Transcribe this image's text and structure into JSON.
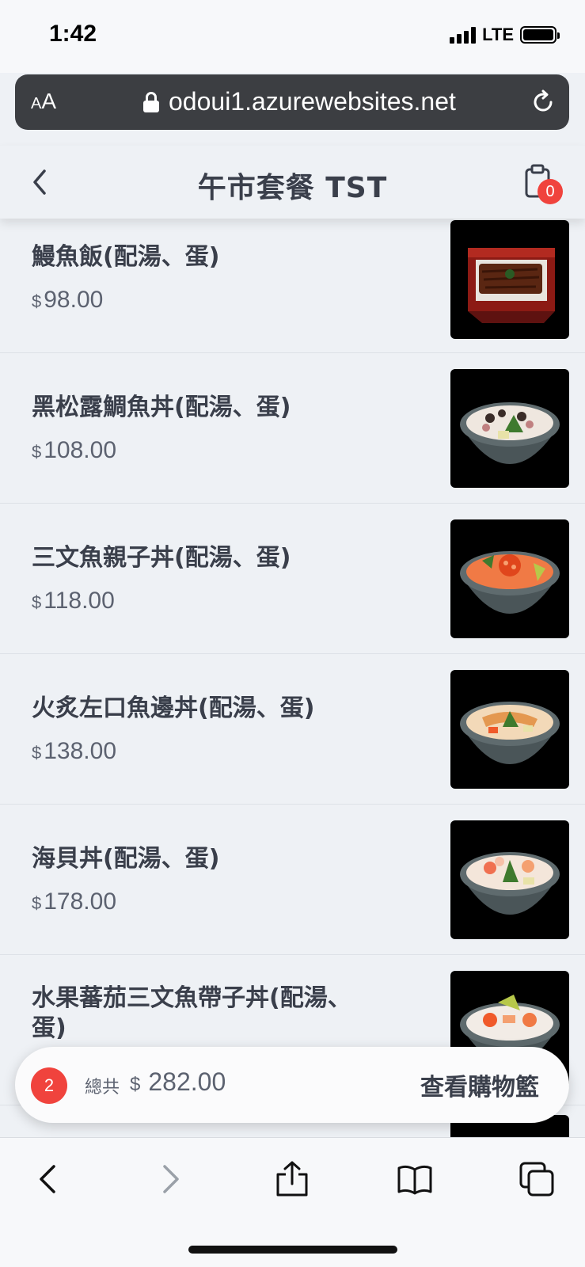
{
  "status_bar": {
    "time": "1:42",
    "network": "LTE"
  },
  "browser": {
    "aa_small": "A",
    "aa_big": "A",
    "url": "odoui1.azurewebsites.net"
  },
  "header": {
    "title": "午市套餐 TST",
    "cart_count": "0"
  },
  "currency": "$",
  "menu": [
    {
      "name": "鰻魚飯(配湯、蛋)",
      "price": "98.00",
      "image": "eel-rice-box"
    },
    {
      "name": "黑松露鯛魚丼(配湯、蛋)",
      "price": "108.00",
      "image": "truffle-sea-bream-bowl"
    },
    {
      "name": "三文魚親子丼(配湯、蛋)",
      "price": "118.00",
      "image": "salmon-roe-bowl"
    },
    {
      "name": "火炙左口魚邊丼(配湯、蛋)",
      "price": "138.00",
      "image": "seared-flounder-bowl"
    },
    {
      "name": "海貝丼(配湯、蛋)",
      "price": "178.00",
      "image": "shellfish-bowl"
    },
    {
      "name": "水果蕃茄三文魚帶子丼(配湯、蛋)",
      "price": "",
      "image": "tomato-salmon-scallop-bowl"
    }
  ],
  "cart_summary": {
    "count": "2",
    "total_label": "總共",
    "total": "282.00",
    "view_cart_label": "查看購物籃"
  },
  "icons": {
    "back": "chevron-left-icon",
    "cart": "clipboard-cart-icon",
    "lock": "lock-icon",
    "reload": "reload-icon",
    "toolbar": [
      "back-arrow-icon",
      "forward-arrow-icon",
      "share-icon",
      "bookmarks-icon",
      "tabs-icon"
    ]
  },
  "colors": {
    "badge": "#f0433d",
    "background": "#eef1f5",
    "url_bar": "#3c3e42"
  }
}
